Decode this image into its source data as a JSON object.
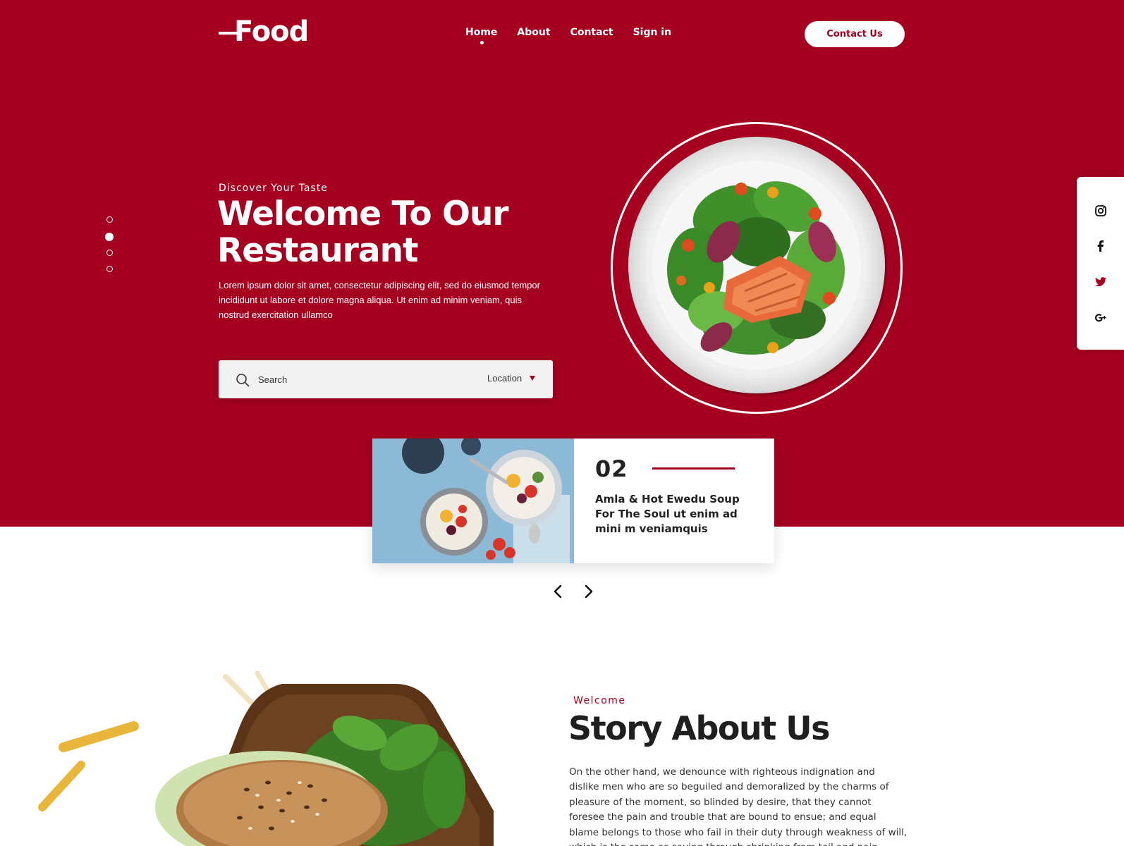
{
  "colors": {
    "brand": "#a50020",
    "white": "#ffffff",
    "text_dark": "#222222"
  },
  "header": {
    "logo_text": "Food",
    "nav": [
      {
        "label": "Home",
        "active": true
      },
      {
        "label": "About",
        "active": false
      },
      {
        "label": "Contact",
        "active": false
      },
      {
        "label": "Sign in",
        "active": false
      }
    ],
    "contact_button": "Contact Us"
  },
  "hero": {
    "eyebrow": "Discover Your Taste",
    "title_line1": "Welcome To Our",
    "title_line2": "Restaurant",
    "description": "Lorem ipsum dolor sit amet, consectetur adipiscing elit, sed do eiusmod tempor incididunt ut labore et dolore magna aliqua. Ut enim ad minim veniam, quis nostrud exercitation ullamco",
    "slider": {
      "count": 4,
      "active": 2
    }
  },
  "search": {
    "placeholder": "Search",
    "location_label": "Location",
    "icon": "search-icon"
  },
  "social": [
    "instagram-icon",
    "facebook-icon",
    "twitter-icon",
    "google-plus-icon"
  ],
  "card": {
    "number": "02",
    "title": "Amla & Hot Ewedu Soup For The Soul ut enim ad mini m veniamquis"
  },
  "carousel": {
    "prev_icon": "chevron-left-icon",
    "next_icon": "chevron-right-icon"
  },
  "about": {
    "eyebrow": "Welcome",
    "title": "Story About Us",
    "text": "On the other hand, we denounce with righteous indignation and dislike men who are so beguiled and demoralized by the charms of pleasure of the moment, so blinded by desire, that they cannot foresee the pain and trouble that are bound to ensue; and equal blame belongs to those who fail in their duty through weakness of will, which is the same as saying through shrinking from toil and pain. These cases are perfectly"
  }
}
